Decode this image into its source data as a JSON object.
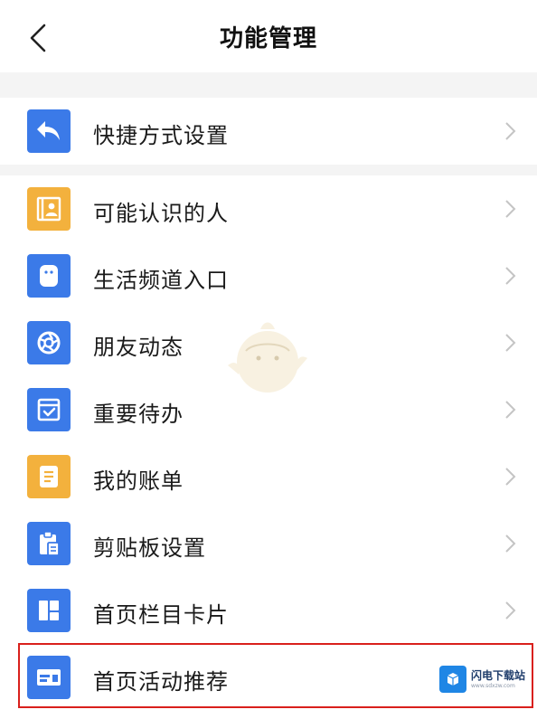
{
  "header": {
    "title": "功能管理"
  },
  "items": [
    {
      "label": "快捷方式设置",
      "icon": "reply-arrow-icon",
      "color": "#3b7ae8"
    },
    {
      "label": "可能认识的人",
      "icon": "contact-card-icon",
      "color": "#f3b13d"
    },
    {
      "label": "生活频道入口",
      "icon": "life-channel-icon",
      "color": "#3b7ae8"
    },
    {
      "label": "朋友动态",
      "icon": "aperture-icon",
      "color": "#3b7ae8"
    },
    {
      "label": "重要待办",
      "icon": "todo-check-icon",
      "color": "#3b7ae8"
    },
    {
      "label": "我的账单",
      "icon": "bill-document-icon",
      "color": "#f3b13d"
    },
    {
      "label": "剪贴板设置",
      "icon": "clipboard-icon",
      "color": "#3b7ae8"
    },
    {
      "label": "首页栏目卡片",
      "icon": "grid-cards-icon",
      "color": "#3b7ae8"
    },
    {
      "label": "首页活动推荐",
      "icon": "banner-card-icon",
      "color": "#3b7ae8"
    }
  ],
  "watermark": {
    "name": "闪电下载站",
    "url": "www.sdxzw.com"
  },
  "accent_colors": {
    "blue": "#3b7ae8",
    "orange": "#f3b13d",
    "highlight_red": "#d9201c"
  }
}
